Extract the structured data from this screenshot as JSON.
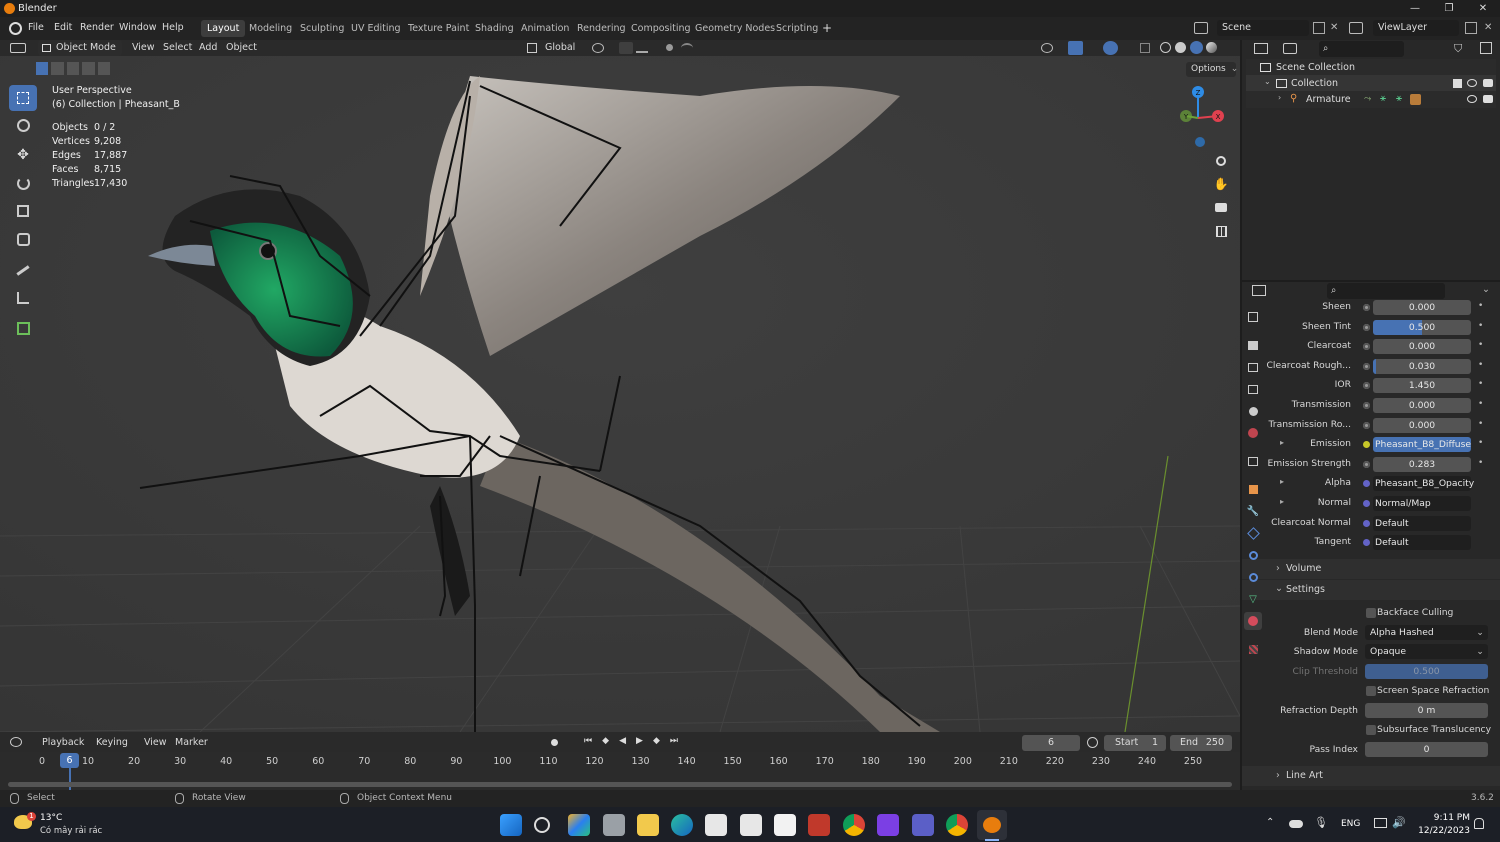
{
  "app": {
    "title": "Blender",
    "version": "3.6.2"
  },
  "window_controls": {
    "minimize": "—",
    "maximize": "❐",
    "close": "✕"
  },
  "menu": [
    "File",
    "Edit",
    "Render",
    "Window",
    "Help"
  ],
  "workspaces": [
    "Layout",
    "Modeling",
    "Sculpting",
    "UV Editing",
    "Texture Paint",
    "Shading",
    "Animation",
    "Rendering",
    "Compositing",
    "Geometry Nodes",
    "Scripting"
  ],
  "workspace_add": "+",
  "scene": {
    "name": "Scene",
    "view_layer": "ViewLayer"
  },
  "viewport_header": {
    "mode": "Object Mode",
    "menus": [
      "View",
      "Select",
      "Add",
      "Object"
    ],
    "orientation": "Global"
  },
  "viewport": {
    "perspective": "User Perspective",
    "collection_info": "(6) Collection | Pheasant_B",
    "options_label": "Options",
    "stats": [
      {
        "label": "Objects",
        "value": "0 / 2"
      },
      {
        "label": "Vertices",
        "value": "9,208"
      },
      {
        "label": "Edges",
        "value": "17,887"
      },
      {
        "label": "Faces",
        "value": "8,715"
      },
      {
        "label": "Triangles",
        "value": "17,430"
      }
    ],
    "gizmo_axes": {
      "z": "Z",
      "x": "X",
      "y": "Y"
    },
    "colors": {
      "x_axis": "#e0414f",
      "y_axis": "#6ba137",
      "z_axis": "#2e8ce6",
      "active_tool": "#4772b3"
    }
  },
  "timeline": {
    "menus": [
      "Playback",
      "Keying",
      "View",
      "Marker"
    ],
    "current_frame": "6",
    "start_label": "Start",
    "start": "1",
    "end_label": "End",
    "end": "250",
    "ticks": [
      "0",
      "10",
      "20",
      "30",
      "40",
      "50",
      "60",
      "70",
      "80",
      "90",
      "100",
      "110",
      "120",
      "130",
      "140",
      "150",
      "160",
      "170",
      "180",
      "190",
      "200",
      "210",
      "220",
      "230",
      "240",
      "250"
    ]
  },
  "status_bar": {
    "select": "Select",
    "rotate": "Rotate View",
    "context_menu": "Object Context Menu"
  },
  "outliner": {
    "root": "Scene Collection",
    "collection": "Collection",
    "object": "Armature"
  },
  "properties": {
    "rows": [
      {
        "label": "Sheen",
        "value": "0.000"
      },
      {
        "label": "Sheen Tint",
        "value": "0.500",
        "fill": 0.5
      },
      {
        "label": "Clearcoat",
        "value": "0.000"
      },
      {
        "label": "Clearcoat Rough...",
        "value": "0.030",
        "fill": 0.03
      },
      {
        "label": "IOR",
        "value": "1.450"
      },
      {
        "label": "Transmission",
        "value": "0.000"
      },
      {
        "label": "Transmission Ro...",
        "value": "0.000"
      },
      {
        "label": "Emission",
        "value": "Pheasant_B8_Diffuse"
      },
      {
        "label": "Emission Strength",
        "value": "0.283"
      },
      {
        "label": "Alpha",
        "value": "Pheasant_B8_Opacity"
      },
      {
        "label": "Normal",
        "value": "Normal/Map"
      },
      {
        "label": "Clearcoat Normal",
        "value": "Default"
      },
      {
        "label": "Tangent",
        "value": "Default"
      }
    ],
    "panels": {
      "volume": "Volume",
      "settings": "Settings",
      "line_art": "Line Art"
    },
    "settings": {
      "backface_culling": "Backface Culling",
      "blend_mode_label": "Blend Mode",
      "blend_mode": "Alpha Hashed",
      "shadow_mode_label": "Shadow Mode",
      "shadow_mode": "Opaque",
      "clip_threshold_label": "Clip Threshold",
      "clip_threshold": "0.500",
      "ssr": "Screen Space Refraction",
      "refraction_depth_label": "Refraction Depth",
      "refraction_depth": "0 m",
      "subsurface": "Subsurface Translucency",
      "pass_index_label": "Pass Index",
      "pass_index": "0"
    }
  },
  "taskbar": {
    "weather_temp": "13°C",
    "weather_desc": "Có mây rải rác",
    "weather_badge": "1",
    "language": "ENG",
    "time": "9:11 PM",
    "date": "12/22/2023"
  }
}
